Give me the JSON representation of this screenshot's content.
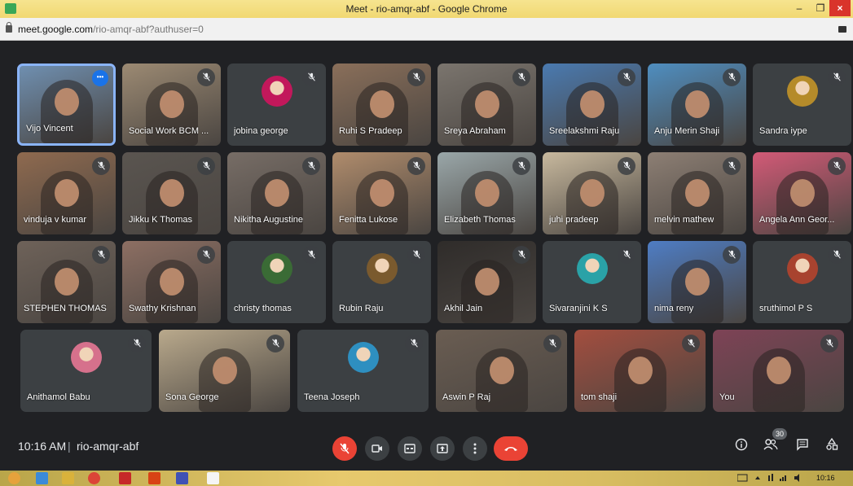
{
  "window": {
    "title": "Meet - rio-amqr-abf - Google Chrome",
    "minimize_label": "–",
    "maximize_label": "❐",
    "close_label": "×"
  },
  "address": {
    "host": "meet.google.com",
    "path": "/rio-amqr-abf?authuser=0"
  },
  "participants": [
    {
      "name": "Vijo Vincent",
      "kind": "video",
      "color": "#6f8fb0"
    },
    {
      "name": "Social Work BCM ...",
      "kind": "video",
      "color": "#9c8a73"
    },
    {
      "name": "jobina george",
      "kind": "avatar",
      "color": "#c2185b"
    },
    {
      "name": "Ruhi S Pradeep",
      "kind": "video",
      "color": "#8a6f5a"
    },
    {
      "name": "Sreya Abraham",
      "kind": "video",
      "color": "#7b756e"
    },
    {
      "name": "Sreelakshmi Raju",
      "kind": "video",
      "color": "#4a7ab0"
    },
    {
      "name": "Anju Merin Shaji",
      "kind": "video",
      "color": "#4f8ec0"
    },
    {
      "name": "Sandra iype",
      "kind": "avatar",
      "color": "#b58b2a"
    },
    {
      "name": "vinduja v kumar",
      "kind": "video",
      "color": "#8f6a4f"
    },
    {
      "name": "Jikku K Thomas",
      "kind": "video",
      "color": "#5a5550"
    },
    {
      "name": "Nikitha Augustine",
      "kind": "video",
      "color": "#776d66"
    },
    {
      "name": "Fenitta Lukose",
      "kind": "video",
      "color": "#b08c6c"
    },
    {
      "name": "Elizabeth Thomas",
      "kind": "video",
      "color": "#9aa7a9"
    },
    {
      "name": "juhi pradeep",
      "kind": "video",
      "color": "#c8b99e"
    },
    {
      "name": "melvin mathew",
      "kind": "video",
      "color": "#8d7f74"
    },
    {
      "name": "Angela Ann Geor...",
      "kind": "video",
      "color": "#d35a77"
    },
    {
      "name": "STEPHEN THOMAS",
      "kind": "video",
      "color": "#6e6259"
    },
    {
      "name": "Swathy Krishnan",
      "kind": "video",
      "color": "#8d6f63"
    },
    {
      "name": "christy thomas",
      "kind": "avatar",
      "color": "#3a6b35"
    },
    {
      "name": "Rubin Raju",
      "kind": "avatar",
      "color": "#7a5a2e"
    },
    {
      "name": "Akhil Jain",
      "kind": "video",
      "color": "#2f2c2a"
    },
    {
      "name": "Sivaranjini K S",
      "kind": "avatar",
      "color": "#2aa2a7"
    },
    {
      "name": "nima reny",
      "kind": "video",
      "color": "#4e7dc4"
    },
    {
      "name": "sruthimol P S",
      "kind": "avatar",
      "color": "#a8432f"
    },
    {
      "name": "Anithamol Babu",
      "kind": "avatar",
      "color": "#d6718c"
    },
    {
      "name": "Sona George",
      "kind": "video",
      "color": "#b9a98c"
    },
    {
      "name": "Teena Joseph",
      "kind": "avatar",
      "color": "#2e8fc0"
    },
    {
      "name": "Aswin P Raj",
      "kind": "video",
      "color": "#6a5d52"
    },
    {
      "name": "tom shaji",
      "kind": "video",
      "color": "#a34e3f"
    },
    {
      "name": "You",
      "kind": "video",
      "color": "#7e4356"
    }
  ],
  "bottom": {
    "time": "10:16 AM",
    "separator": "|",
    "meeting_code": "rio-amqr-abf",
    "participants_count": "30",
    "mic_icon": "mic-off-icon",
    "camera_icon": "camera-icon",
    "captions_icon": "captions-icon",
    "present_icon": "present-icon",
    "more_icon": "more-vert-icon",
    "hangup_icon": "hang-up-icon"
  },
  "taskbar": {
    "time": "10:16"
  },
  "colors": {
    "meet_bg": "#202124",
    "tile_bg": "#3c4043",
    "active_border": "#8ab4f8",
    "red": "#ea4335"
  }
}
